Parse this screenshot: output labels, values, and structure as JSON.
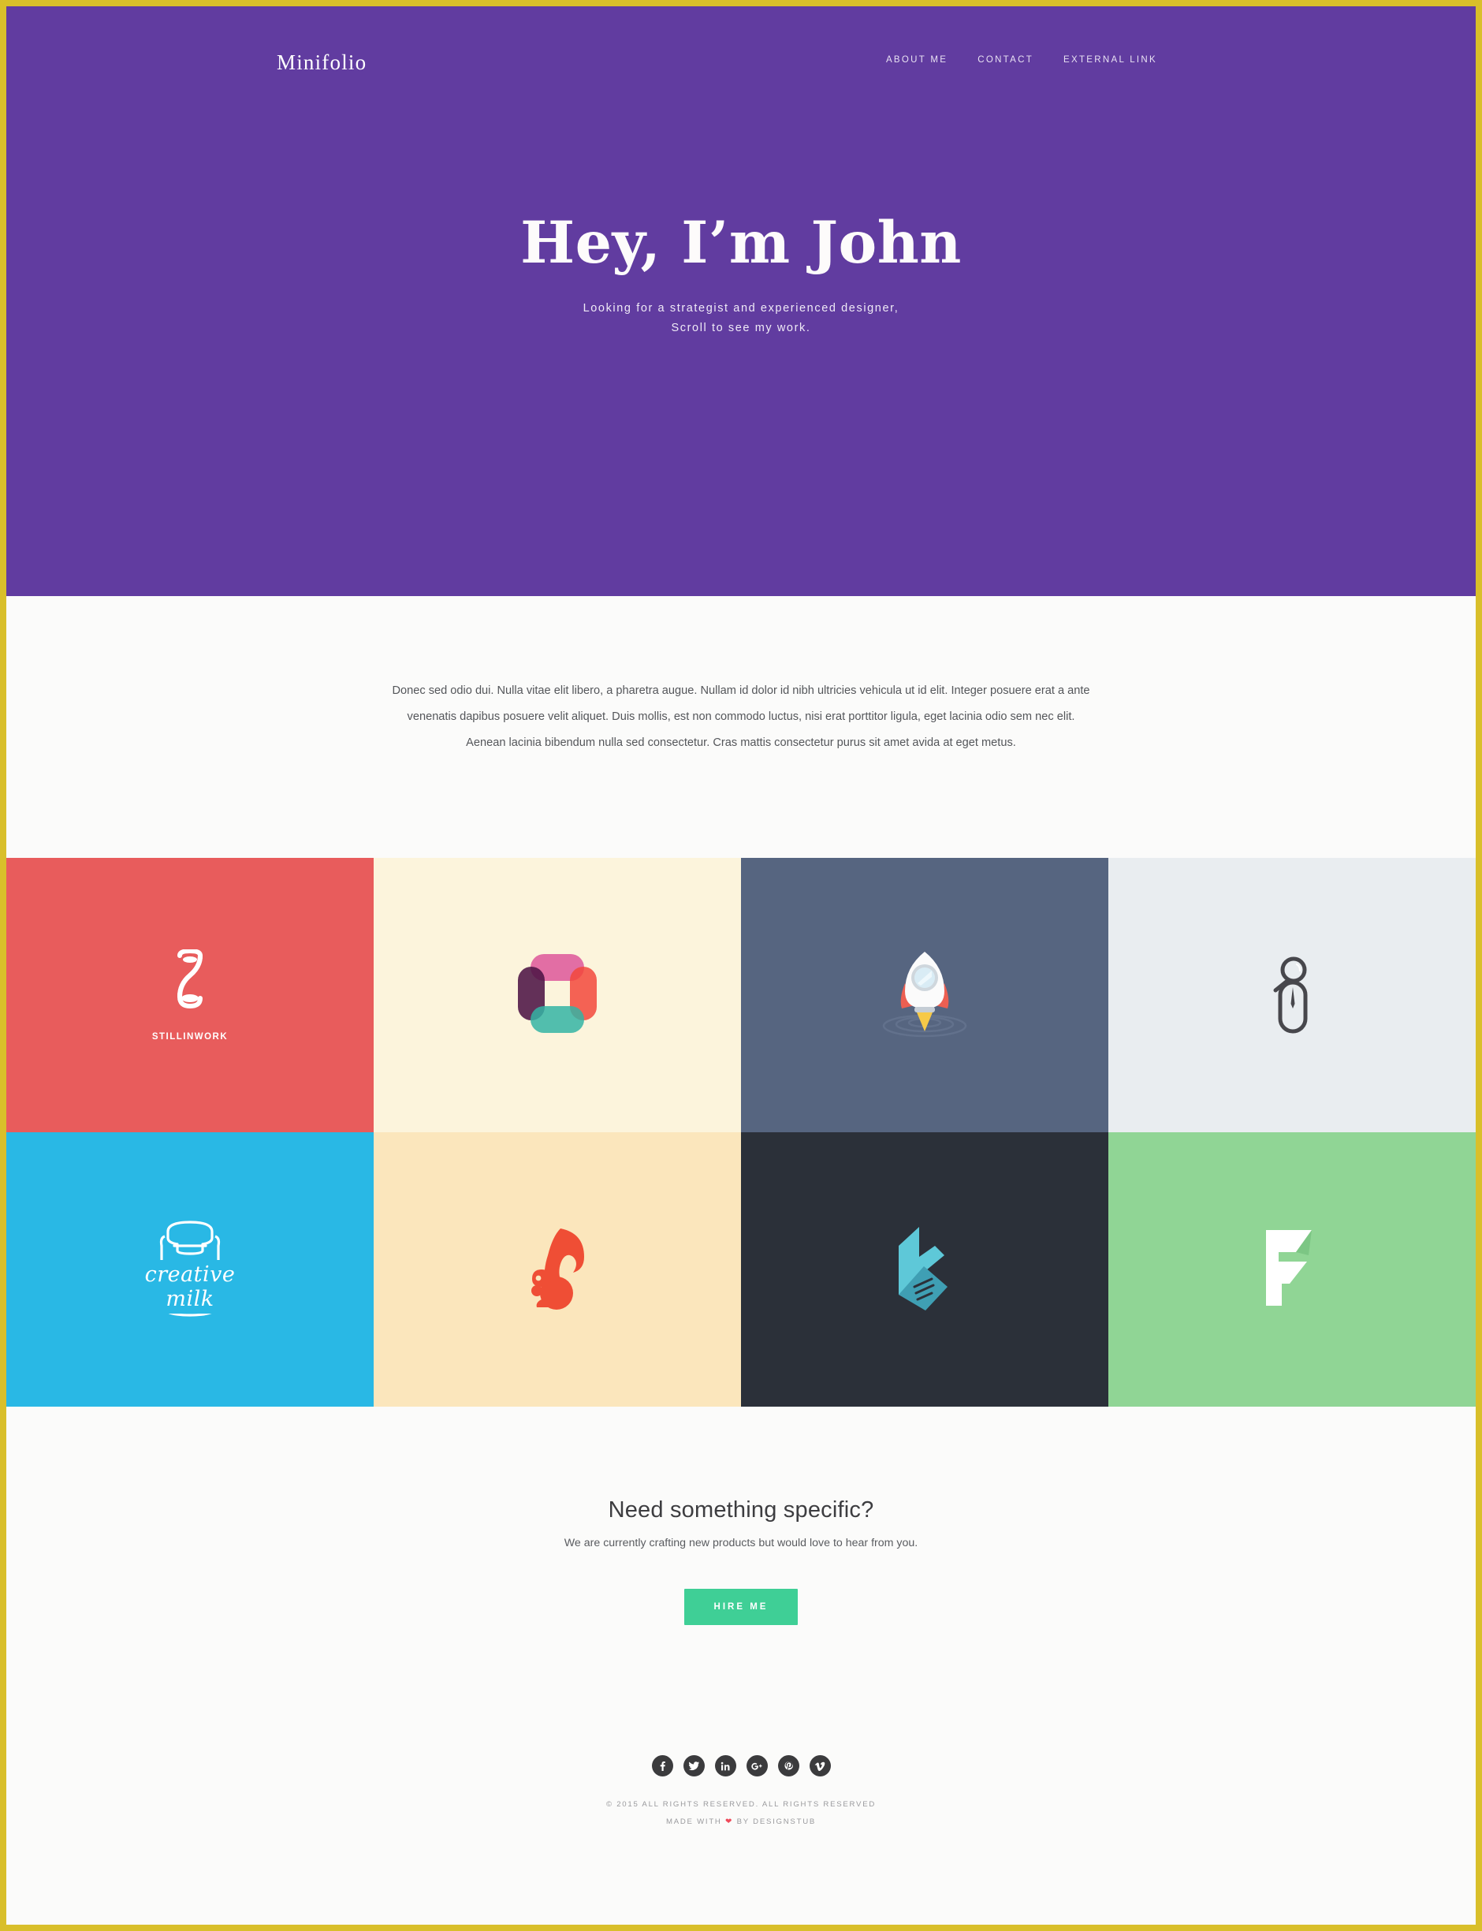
{
  "site": {
    "brand": "Minifolio",
    "accent_purple": "#613ca0",
    "accent_green": "#3fcf96",
    "frame_color": "#d9bf2a",
    "page_bg": "#fbfbfa"
  },
  "nav": {
    "items": [
      {
        "label": "ABOUT ME",
        "name": "nav-about-me"
      },
      {
        "label": "CONTACT",
        "name": "nav-contact"
      },
      {
        "label": "EXTERNAL LINK",
        "name": "nav-external-link"
      }
    ]
  },
  "hero": {
    "title": "Hey, I’m John",
    "subtitle_line1": "Looking for a strategist and experienced designer,",
    "subtitle_line2": "Scroll to see my work."
  },
  "intro": {
    "paragraph": "Donec sed odio dui. Nulla vitae elit libero, a pharetra augue. Nullam id dolor id nibh ultricies vehicula ut id elit. Integer posuere erat a ante venenatis dapibus posuere velit aliquet. Duis mollis, est non commodo luctus, nisi erat porttitor ligula, eget lacinia odio sem nec elit. Aenean lacinia bibendum nulla sed consectetur. Cras mattis consectetur purus sit amet avida at eget metus."
  },
  "portfolio": {
    "tiles": [
      {
        "name": "tile-stillinwork",
        "icon": "hourglass-icon",
        "label": "STILLINWORK",
        "bg": "#e85c5c"
      },
      {
        "name": "tile-square-frame",
        "icon": "color-square-frame-icon",
        "label": "",
        "bg": "#fcf4dc"
      },
      {
        "name": "tile-rocket",
        "icon": "rocket-icon",
        "label": "",
        "bg": "#566580"
      },
      {
        "name": "tile-magnifier-mouse",
        "icon": "magnifier-mouse-icon",
        "label": "",
        "bg": "#e9edf0"
      },
      {
        "name": "tile-creative-milk",
        "icon": "milk-can-icon",
        "label": "creative milk",
        "bg": "#29b8e5"
      },
      {
        "name": "tile-squirrel",
        "icon": "squirrel-icon",
        "label": "",
        "bg": "#fbe6bc"
      },
      {
        "name": "tile-angular-k",
        "icon": "angular-k-logo-icon",
        "label": "",
        "bg": "#2b3039"
      },
      {
        "name": "tile-angular-f",
        "icon": "angular-f-logo-icon",
        "label": "",
        "bg": "#90d595"
      }
    ]
  },
  "cta": {
    "title": "Need something specific?",
    "subtitle": "We are currently crafting new products but would love to hear from you.",
    "button_label": "HIRE ME"
  },
  "footer": {
    "socials": [
      {
        "name": "facebook-icon",
        "label": "f"
      },
      {
        "name": "twitter-icon",
        "label": "t"
      },
      {
        "name": "linkedin-icon",
        "label": "in"
      },
      {
        "name": "google-plus-icon",
        "label": "g+"
      },
      {
        "name": "pinterest-icon",
        "label": "p"
      },
      {
        "name": "vimeo-icon",
        "label": "v"
      }
    ],
    "copyright": "© 2015 ALL RIGHTS RESERVED. ALL RIGHTS RESERVED",
    "made_with_prefix": "MADE WITH",
    "made_with_suffix": "BY DESIGNSTUB"
  }
}
